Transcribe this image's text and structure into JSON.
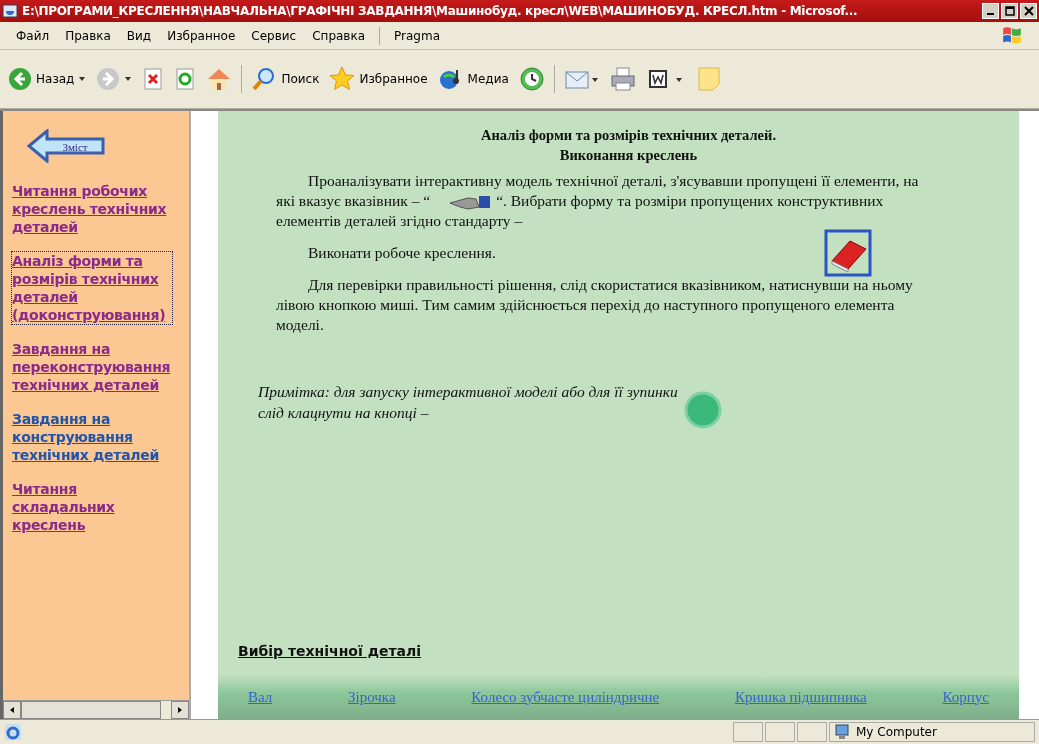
{
  "window": {
    "title": "E:\\ПРОГРАМИ_КРЕСЛЕННЯ\\НАВЧАЛЬНА\\ГРАФІЧНІ ЗАВДАННЯ\\Машинобуд. кресл\\WEB\\МАШИНОБУД. КРЕСЛ.htm - Microsof..."
  },
  "menu": [
    {
      "label": "Файл"
    },
    {
      "label": "Правка"
    },
    {
      "label": "Вид"
    },
    {
      "label": "Избранное"
    },
    {
      "label": "Сервис"
    },
    {
      "label": "Справка"
    },
    {
      "label": "Pragma"
    }
  ],
  "toolbar": [
    {
      "kind": "back",
      "label": "Назад"
    },
    {
      "kind": "forward"
    },
    {
      "kind": "stop"
    },
    {
      "kind": "refresh"
    },
    {
      "kind": "home"
    },
    {
      "kind": "search",
      "label": "Поиск"
    },
    {
      "kind": "favorites",
      "label": "Избранное"
    },
    {
      "kind": "media",
      "label": "Медиа"
    },
    {
      "kind": "history"
    },
    {
      "kind": "mail"
    },
    {
      "kind": "print"
    },
    {
      "kind": "word"
    },
    {
      "kind": "note"
    }
  ],
  "sidebar": {
    "back_label": "Зміст",
    "items": [
      {
        "label": "Читання робочих креслень технічних деталей",
        "visited": true,
        "focused": false
      },
      {
        "label": "Аналіз форми та розмірів технічних деталей (доконструювання)",
        "visited": true,
        "focused": true
      },
      {
        "label": "Завдання на переконструювання технічних деталей",
        "visited": true,
        "focused": false
      },
      {
        "label": "Завдання на конструювання технічних деталей",
        "visited": false,
        "focused": false
      },
      {
        "label": "Читання складальних креслень",
        "visited": true,
        "focused": false
      }
    ]
  },
  "content": {
    "title_lines": [
      "Аналіз форми та розмірів технічних деталей.",
      "Виконання креслень"
    ],
    "para1_start": "Проаналізувати інтерактивну модель технічної деталі, з'ясувавши пропущені її елементи, на які вказує вказівник – “",
    "para1_end": "“. Вибрати форму та розміри пропущених конструктивних елементів деталей згідно стандарту –",
    "para2": "Виконати робоче креслення.",
    "para3": "Для перевірки правильності рішення, слід скористатися вказівником, натиснувши на ньому лівою кнопкою миші. Тим самим здійснюється перехід до наступного пропущеного елемента моделі.",
    "note": "Примітка: для запуску інтерактивної моделі або для її зупинки слід клацнути на кнопці –",
    "selection_heading": "Вибір технічної деталі",
    "parts": [
      {
        "label": "Вал"
      },
      {
        "label": "Зірочка"
      },
      {
        "label": "Колесо зубчасте циліндричне"
      },
      {
        "label": "Кришка підшипника"
      },
      {
        "label": "Корпус"
      }
    ]
  },
  "status_bar": {
    "zone": "My Computer"
  }
}
